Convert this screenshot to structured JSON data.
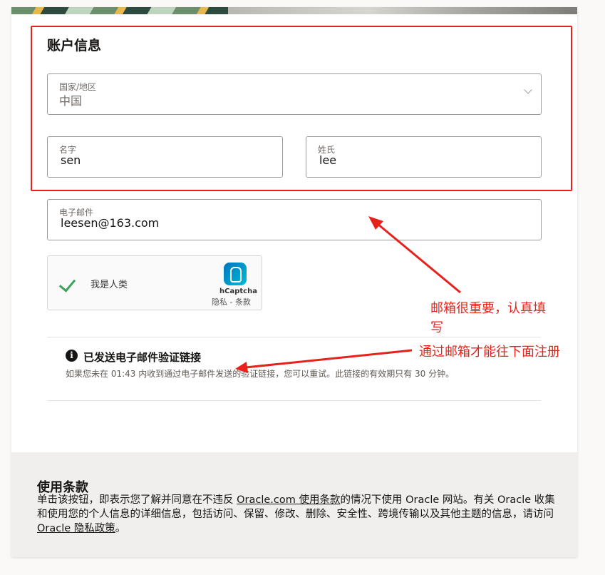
{
  "account_section": {
    "title": "账户信息",
    "country": {
      "label": "国家/地区",
      "value": "中国"
    },
    "first_name": {
      "label": "名字",
      "value": "sen"
    },
    "last_name": {
      "label": "姓氏",
      "value": "lee"
    }
  },
  "email": {
    "label": "电子邮件",
    "value": "leesen@163.com"
  },
  "captcha": {
    "label": "我是人类",
    "brand": "hCaptcha",
    "links": "隐私 - 条款",
    "logo_icon": "hcaptcha-logo-icon",
    "check_icon": "check-icon"
  },
  "verification_notice": {
    "icon": "info-icon",
    "title": "已发送电子邮件验证链接",
    "text": "如果您未在 01:43 内收到通过电子邮件发送的验证链接，您可以重试。此链接的有效期只有 30 分钟。"
  },
  "annotations": {
    "email_note_line1": "邮箱很重要，认真填",
    "email_note_line2": "写",
    "verify_note": "通过邮箱才能往下面注册",
    "color": "#e6231b"
  },
  "terms": {
    "title": "使用条款",
    "text_1": "单击该按钮，即表示您了解并同意在不违反 ",
    "link_terms": "Oracle.com 使用条款",
    "text_2": "的情况下使用 Oracle 网站。有关 Oracle 收集和使用您的个人信息的详细信息，包括访问、保留、修改、删除、安全性、跨境传输以及其他主题的信息，请访问 ",
    "link_privacy": "Oracle 隐私政策",
    "text_3": "。"
  }
}
